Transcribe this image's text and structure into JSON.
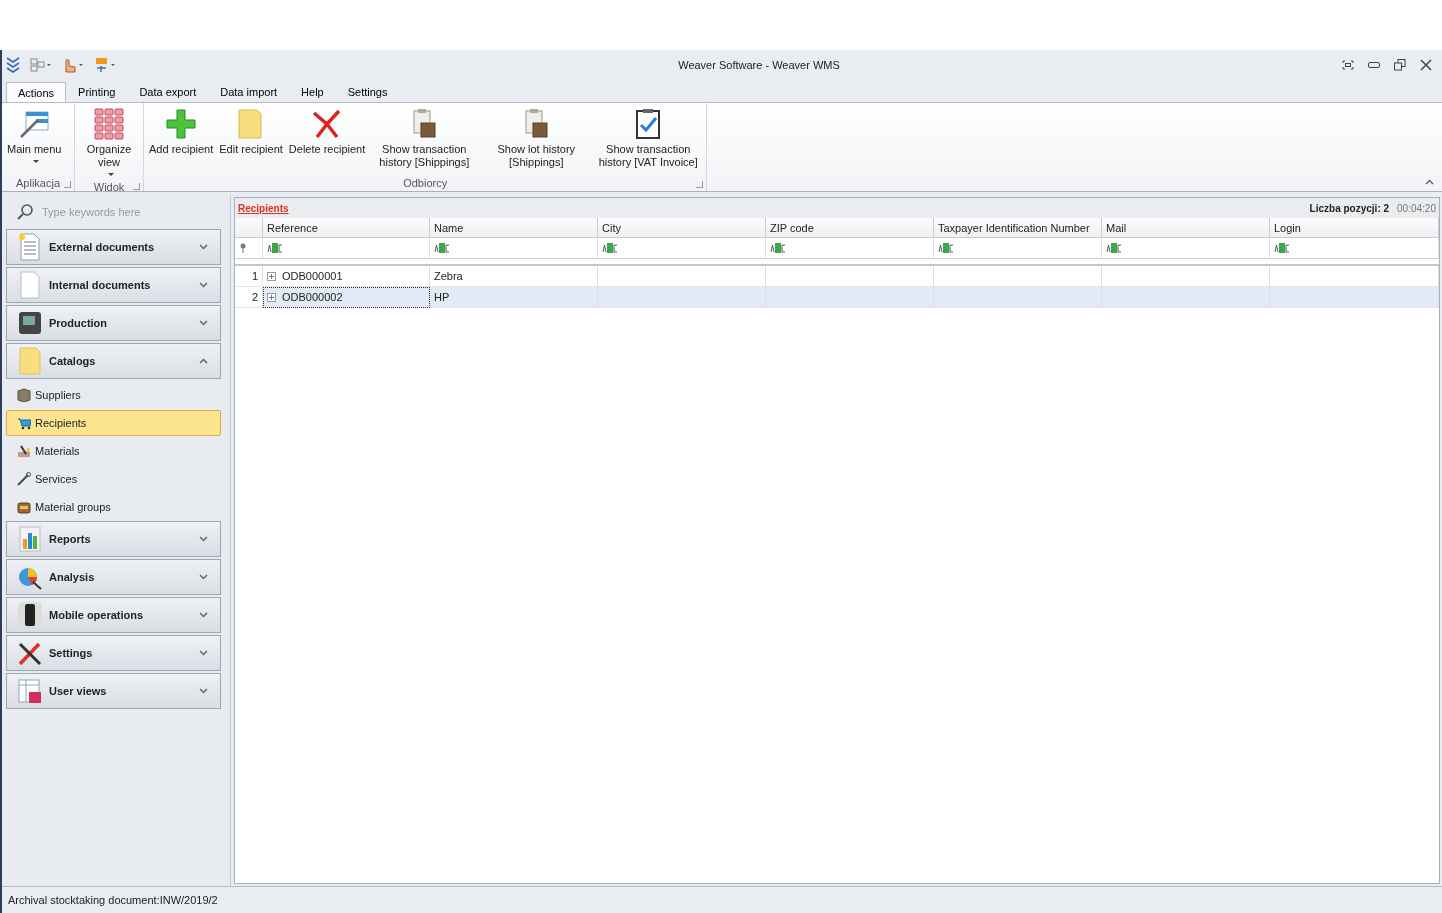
{
  "window": {
    "title": "Weaver Software - Weaver WMS"
  },
  "ribbon": {
    "tabs": [
      {
        "label": "Actions",
        "selected": true
      },
      {
        "label": "Printing",
        "selected": false
      },
      {
        "label": "Data export",
        "selected": false
      },
      {
        "label": "Data import",
        "selected": false
      },
      {
        "label": "Help",
        "selected": false
      },
      {
        "label": "Settings",
        "selected": false
      }
    ],
    "groups": [
      {
        "label": "Aplikacja",
        "buttons": [
          {
            "label": "Main menu",
            "kind": "menu",
            "dropdown": true
          }
        ]
      },
      {
        "label": "Widok",
        "buttons": [
          {
            "label": "Organize view",
            "kind": "grid",
            "dropdown": true
          }
        ]
      },
      {
        "label": "Odbiorcy",
        "buttons": [
          {
            "label": "Add recipient",
            "kind": "add",
            "dropdown": false
          },
          {
            "label": "Edit recipient",
            "kind": "edit",
            "dropdown": false
          },
          {
            "label": "Delete recipient",
            "kind": "delete",
            "dropdown": false
          },
          {
            "label": "Show transaction history [Shippings]",
            "kind": "history",
            "dropdown": false
          },
          {
            "label": "Show lot history [Shippings]",
            "kind": "history",
            "dropdown": false
          },
          {
            "label": "Show transaction history [VAT Invoice]",
            "kind": "invoice",
            "dropdown": false
          }
        ]
      }
    ]
  },
  "sidebar": {
    "search": {
      "placeholder": "Type keywords here"
    },
    "sections": [
      {
        "label": "External documents",
        "kind": "document",
        "expanded": false
      },
      {
        "label": "Internal documents",
        "kind": "page",
        "expanded": false
      },
      {
        "label": "Production",
        "kind": "machine",
        "expanded": false
      },
      {
        "label": "Catalogs",
        "kind": "folder",
        "expanded": true,
        "items": [
          {
            "label": "Suppliers",
            "kind": "box",
            "selected": false
          },
          {
            "label": "Recipients",
            "kind": "cart",
            "selected": true
          },
          {
            "label": "Materials",
            "kind": "materials",
            "selected": false
          },
          {
            "label": "Services",
            "kind": "wrench",
            "selected": false
          },
          {
            "label": "Material groups",
            "kind": "crate",
            "selected": false
          }
        ]
      },
      {
        "label": "Reports",
        "kind": "chart",
        "expanded": false
      },
      {
        "label": "Analysis",
        "kind": "analysis",
        "expanded": false
      },
      {
        "label": "Mobile operations",
        "kind": "phone",
        "expanded": false
      },
      {
        "label": "Settings",
        "kind": "tools",
        "expanded": false
      },
      {
        "label": "User views",
        "kind": "table",
        "expanded": false
      }
    ]
  },
  "grid": {
    "title": "Recipients",
    "count": "Liczba pozycji: 2",
    "time": "00:04:20",
    "columns": [
      "Reference",
      "Name",
      "City",
      "ZIP code",
      "Taxpayer Identification Number",
      "Mail",
      "Login"
    ],
    "rows": [
      {
        "number": "1",
        "cells": [
          "ODB000001",
          "Zebra",
          "",
          "",
          "",
          "",
          ""
        ],
        "selected": false
      },
      {
        "number": "2",
        "cells": [
          "ODB000002",
          "HP",
          "",
          "",
          "",
          "",
          ""
        ],
        "selected": true
      }
    ]
  },
  "status_bar": {
    "text": "Archival stocktaking document:INW/2019/2"
  }
}
